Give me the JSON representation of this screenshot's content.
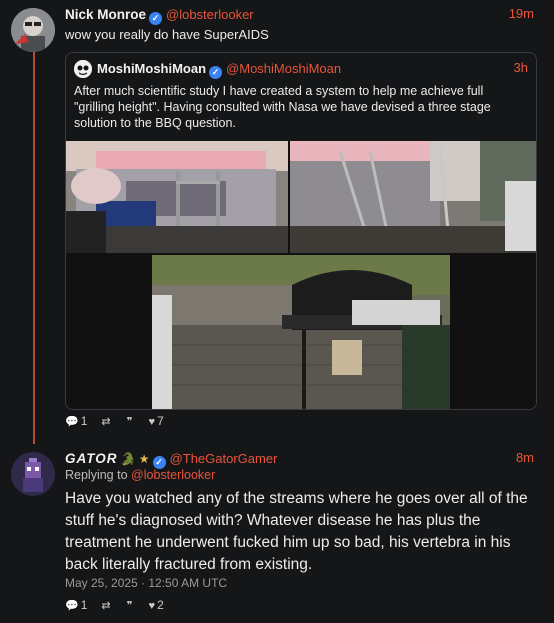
{
  "post1": {
    "author": "Nick Monroe",
    "handle": "@lobsterlooker",
    "time": "19m",
    "text": "wow you really do have SuperAIDS",
    "quote": {
      "author": "MoshiMoshiMoan",
      "handle": "@MoshiMoshiMoan",
      "time": "3h",
      "text": "After much scientific study I have created a system to help me achieve full \"grilling height\".  Having consulted with Nasa we have devised a three stage solution to the BBQ question."
    },
    "actions": {
      "replies": "1",
      "reposts": "",
      "quotes": "",
      "likes": "7"
    }
  },
  "post2": {
    "author": "GATOR",
    "author_emoji": "🐊 ★",
    "handle": "@TheGatorGamer",
    "time": "8m",
    "replying_prefix": "Replying to",
    "replying_to": "@lobsterlooker",
    "text": "Have you watched any of the streams where he goes over all of the stuff he's diagnosed with? Whatever disease he has plus the treatment he underwent fucked him up so bad, his vertebra in his back literally fractured from existing.",
    "timestamp": "May 25, 2025 · 12:50 AM UTC",
    "actions": {
      "replies": "1",
      "reposts": "",
      "quotes": "",
      "likes": "2"
    }
  },
  "icons": {
    "reply": "💬",
    "repost": "⇄",
    "quote": "❞",
    "like": "♥"
  },
  "colors": {
    "accent": "#e8553a",
    "background": "#151618",
    "verified": "#3b82f6"
  }
}
